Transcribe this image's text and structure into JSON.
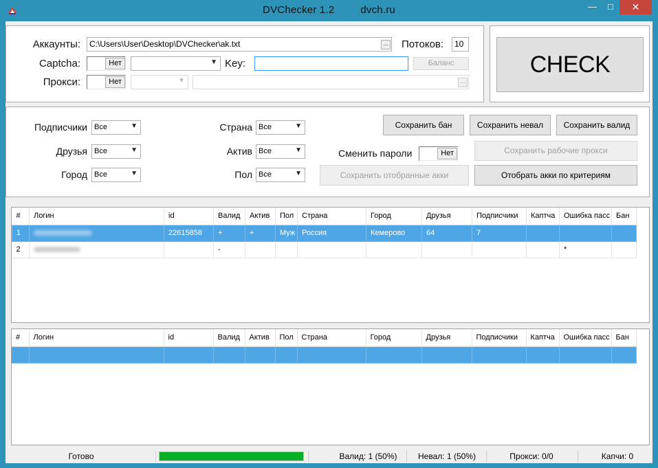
{
  "window": {
    "title": "DVChecker 1.2",
    "site": "dvch.ru",
    "minimize": "—",
    "maximize": "□",
    "close": "✕"
  },
  "top": {
    "accounts_label": "Аккаунты:",
    "accounts_path": "C:\\Users\\User\\Desktop\\DVChecker\\ak.txt",
    "browse": "...",
    "threads_label": "Потоков:",
    "threads_value": "10",
    "captcha_label": "Captcha:",
    "captcha_toggle": "Нет",
    "key_label": "Key:",
    "balance_button": "Баланс",
    "proxy_label": "Прокси:",
    "proxy_toggle": "Нет",
    "check_button": "CHECK"
  },
  "filters": {
    "subscribers_label": "Подписчики",
    "subscribers_value": "Все",
    "friends_label": "Друзья",
    "friends_value": "Все",
    "city_label": "Город",
    "city_value": "Все",
    "country_label": "Страна",
    "country_value": "Все",
    "active_label": "Актив",
    "active_value": "Все",
    "gender_label": "Пол",
    "gender_value": "Все",
    "change_passwords_label": "Сменить пароли",
    "change_passwords_toggle": "Нет"
  },
  "actions": {
    "save_ban": "Сохранить бан",
    "save_invalid": "Сохранить невал",
    "save_valid": "Сохранить валид",
    "save_working_proxies": "Сохранить рабочие прокси",
    "save_selected_accounts": "Сохранить отобранные акки",
    "select_by_criteria": "Отобрать акки по критериям"
  },
  "columns": [
    "#",
    "Логин",
    "id",
    "Валид",
    "Актив",
    "Пол",
    "Страна",
    "Город",
    "Друзья",
    "Подписчики",
    "Каптча",
    "Ошибка пасс",
    "Бан"
  ],
  "results": [
    {
      "num": "1",
      "login": "",
      "id": "22615858",
      "valid": "+",
      "active": "+",
      "gender": "Муж",
      "country": "Россия",
      "city": "Кемерово",
      "friends": "64",
      "subscribers": "7",
      "captcha": "",
      "pass_error": "",
      "ban": ""
    },
    {
      "num": "2",
      "login": "",
      "id": "",
      "valid": "-",
      "active": "",
      "gender": "",
      "country": "",
      "city": "",
      "friends": "",
      "subscribers": "",
      "captcha": "",
      "pass_error": "*",
      "ban": ""
    }
  ],
  "status": {
    "state": "Готово",
    "progress": 1.0,
    "valid": "Валид: 1 (50%)",
    "invalid": "Невал: 1 (50%)",
    "proxies": "Прокси: 0/0",
    "captchas": "Капчи: 0"
  },
  "colors": {
    "title_bar": "#2e93b8",
    "selection": "#4fa6e6",
    "progress": "#06b025",
    "close_button": "#c7463c"
  }
}
